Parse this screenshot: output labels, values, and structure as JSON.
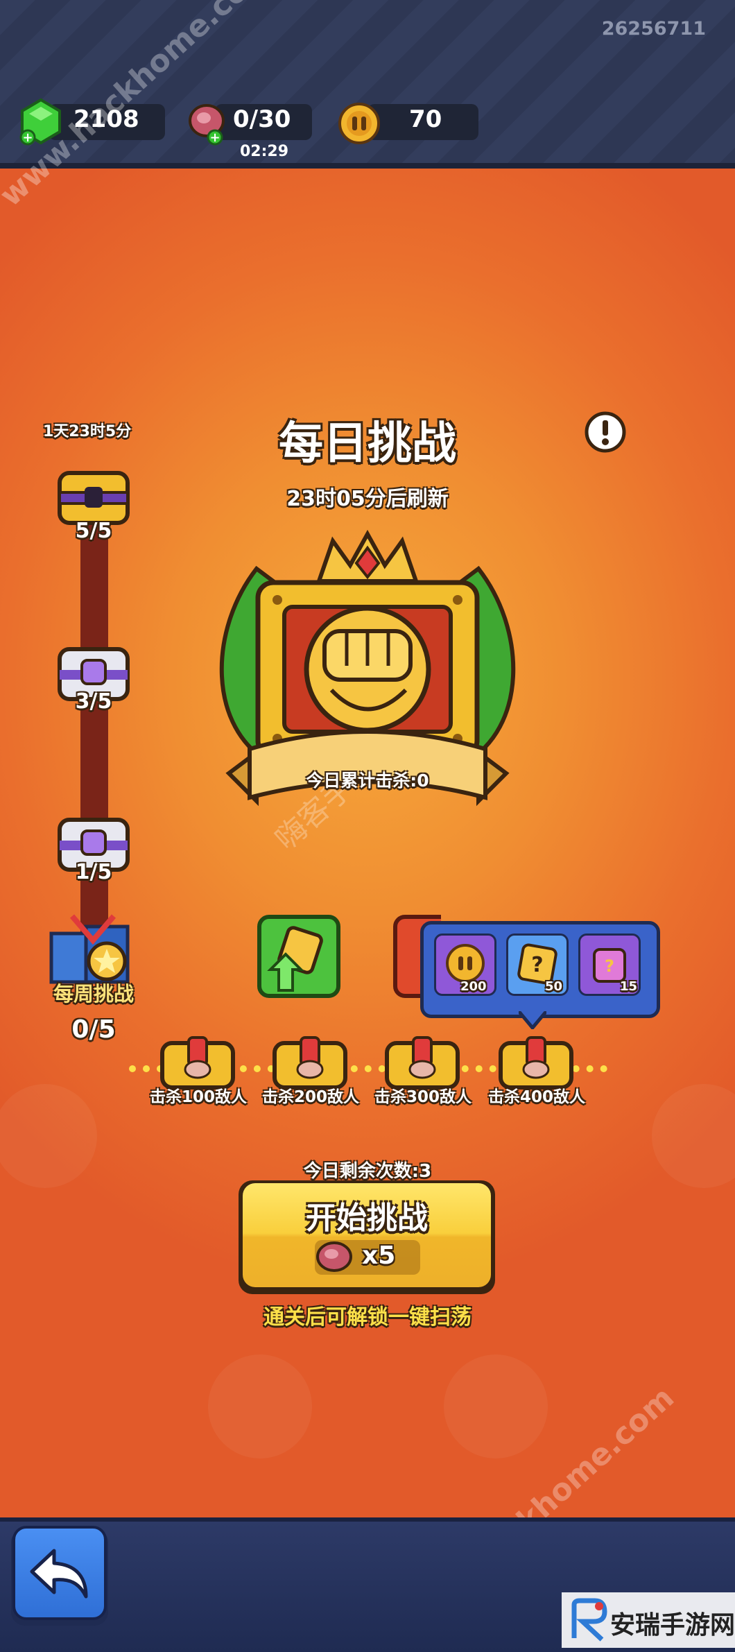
{
  "header": {
    "user_id": "26256711",
    "gems": "2108",
    "energy": "0/30",
    "energy_timer": "02:29",
    "coins": "70"
  },
  "daily": {
    "title": "每日挑战",
    "refresh": "23时05分后刷新",
    "kills_today": "今日累计击杀:0"
  },
  "weekly": {
    "timer": "1天23时5分",
    "chests": [
      {
        "progress": "5/5"
      },
      {
        "progress": "3/5"
      },
      {
        "progress": "1/5"
      }
    ],
    "label": "每周挑战",
    "progress": "0/5"
  },
  "rewards_popup": {
    "items": [
      {
        "icon": "coin-icon",
        "amount": "200"
      },
      {
        "icon": "mystery-box-icon",
        "amount": "50"
      },
      {
        "icon": "chest-card-icon",
        "amount": "15"
      }
    ]
  },
  "kill_chests": [
    {
      "label": "击杀100敌人"
    },
    {
      "label": "击杀200敌人"
    },
    {
      "label": "击杀300敌人"
    },
    {
      "label": "击杀400敌人"
    }
  ],
  "start": {
    "remaining": "今日剩余次数:3",
    "button_label": "开始挑战",
    "cost": "x5",
    "unlock_hint": "通关后可解锁一键扫荡"
  },
  "watermarks": [
    "www.hackhome.com",
    "嗨客手",
    "www.hackhome.com",
    "安瑞手游网"
  ],
  "colors": {
    "accent_orange": "#f08e32",
    "gold": "#f5c542",
    "navy": "#2a3350"
  }
}
